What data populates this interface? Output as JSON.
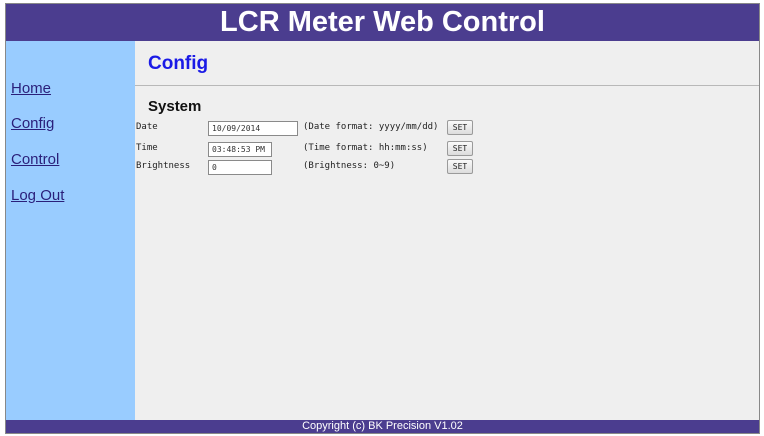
{
  "header": {
    "title": "LCR Meter Web Control"
  },
  "sidebar": {
    "items": [
      {
        "label": "Home"
      },
      {
        "label": "Config"
      },
      {
        "label": "Control"
      },
      {
        "label": "Log Out"
      }
    ]
  },
  "main": {
    "page_title": "Config",
    "section_title": "System",
    "rows": [
      {
        "label": "Date",
        "value": "10/09/2014",
        "hint": "(Date format: yyyy/mm/dd)",
        "button": "SET"
      },
      {
        "label": "Time",
        "value": "03:48:53 PM",
        "hint": "(Time format: hh:mm:ss)",
        "button": "SET"
      },
      {
        "label": "Brightness",
        "value": "0",
        "hint": "(Brightness: 0~9)",
        "button": "SET"
      }
    ]
  },
  "footer": {
    "text": "Copyright (c) BK Precision V1.02"
  },
  "colors": {
    "header_bg": "#4b3d8f",
    "sidebar_bg": "#99ccff",
    "main_bg": "#efefef",
    "page_title": "#1a1ae6",
    "nav_link": "#2a1f7a"
  }
}
